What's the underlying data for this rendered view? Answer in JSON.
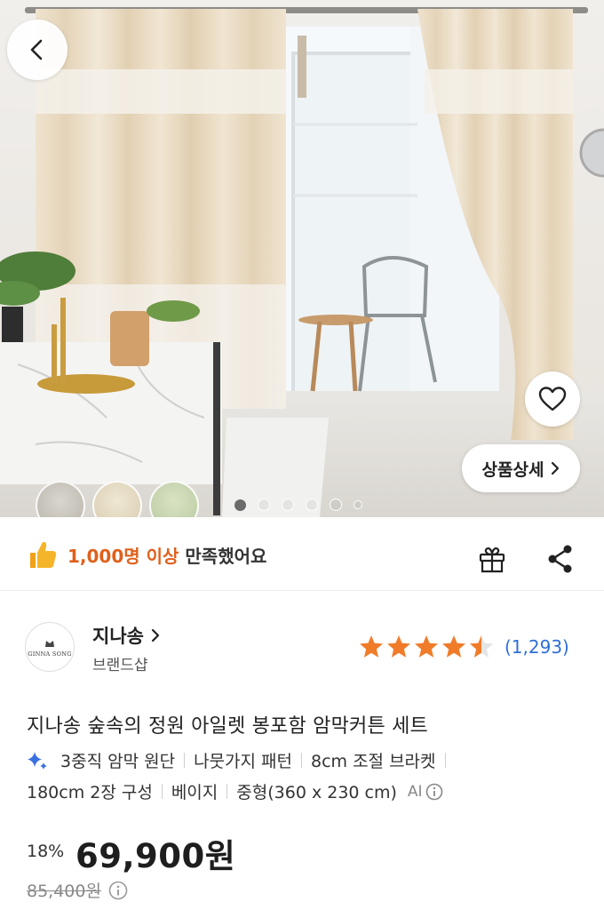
{
  "hero": {
    "detail_button_label": "상품상세",
    "carousel_dot_count": 6,
    "carousel_active_index": 0,
    "option_swatches": [
      "gray",
      "beige",
      "green"
    ]
  },
  "satisfaction": {
    "highlight": "1,000명 이상",
    "rest": " 만족했어요"
  },
  "brand": {
    "name": "지나송",
    "subtitle": "브랜드샵",
    "logo_text": "GINNA SONG"
  },
  "rating": {
    "score": 4.5,
    "count": "(1,293)"
  },
  "product": {
    "title": "지나송 숲속의 정원 아일렛 봉포함 암막커튼 세트",
    "tags_line1": [
      "3중직 암막 원단",
      "나뭇가지 패턴",
      "8cm 조절 브라켓"
    ],
    "tags_line2": [
      "180cm 2장 구성",
      "베이지",
      "중형(360 x 230 cm)"
    ],
    "ai_label": "AI"
  },
  "price": {
    "discount": "18%",
    "current": "69,900원",
    "original": "85,400원"
  },
  "colors": {
    "accent_orange": "#e0601c",
    "star": "#f07c2a",
    "link_blue": "#2f6fd6"
  },
  "icons": [
    "back-arrow-icon",
    "heart-icon",
    "chevron-right-icon",
    "thumbs-up-icon",
    "gift-icon",
    "share-icon",
    "sparkle-icon",
    "info-icon"
  ]
}
